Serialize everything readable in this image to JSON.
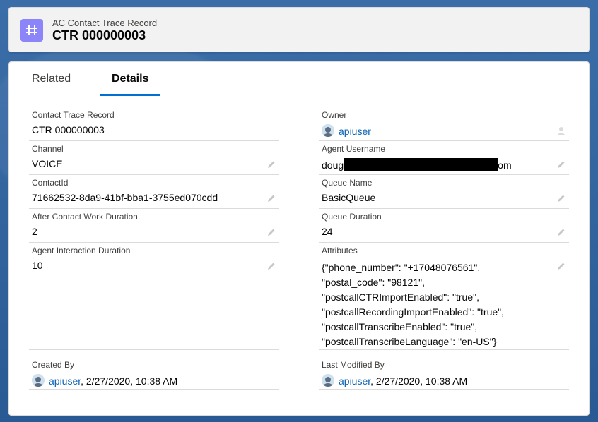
{
  "header": {
    "object_type": "AC Contact Trace Record",
    "record_name": "CTR 000000003",
    "icon": "ctr-object-icon"
  },
  "tabs": [
    {
      "label": "Related",
      "active": false
    },
    {
      "label": "Details",
      "active": true
    }
  ],
  "fields_left": {
    "contact_trace_record": {
      "label": "Contact Trace Record",
      "value": "CTR 000000003"
    },
    "channel": {
      "label": "Channel",
      "value": "VOICE"
    },
    "contact_id": {
      "label": "ContactId",
      "value": "71662532-8da9-41bf-bba1-3755ed070cdd"
    },
    "acw_duration": {
      "label": "After Contact Work Duration",
      "value": "2"
    },
    "agent_interaction_duration": {
      "label": "Agent Interaction Duration",
      "value": "10"
    }
  },
  "fields_right": {
    "owner": {
      "label": "Owner",
      "value": "apiuser"
    },
    "agent_username": {
      "label": "Agent Username",
      "value_start": "doug",
      "value_end": "om"
    },
    "queue_name": {
      "label": "Queue Name",
      "value": "BasicQueue"
    },
    "queue_duration": {
      "label": "Queue Duration",
      "value": "24"
    },
    "attributes": {
      "label": "Attributes",
      "lines": [
        "{\"phone_number\": \"+17048076561\",",
        "\"postal_code\": \"98121\",",
        "\"postcallCTRImportEnabled\": \"true\",",
        "\"postcallRecordingImportEnabled\": \"true\",",
        "\"postcallTranscribeEnabled\": \"true\",",
        "\"postcallTranscribeLanguage\": \"en-US\"}"
      ]
    }
  },
  "system": {
    "created_by": {
      "label": "Created By",
      "user": "apiuser",
      "date": ", 2/27/2020, 10:38 AM"
    },
    "last_modified_by": {
      "label": "Last Modified By",
      "user": "apiuser",
      "date": ", 2/27/2020, 10:38 AM"
    }
  },
  "colors": {
    "brand": "#0070d2",
    "link": "#0a62b3",
    "object_icon": "#8b85f9"
  }
}
